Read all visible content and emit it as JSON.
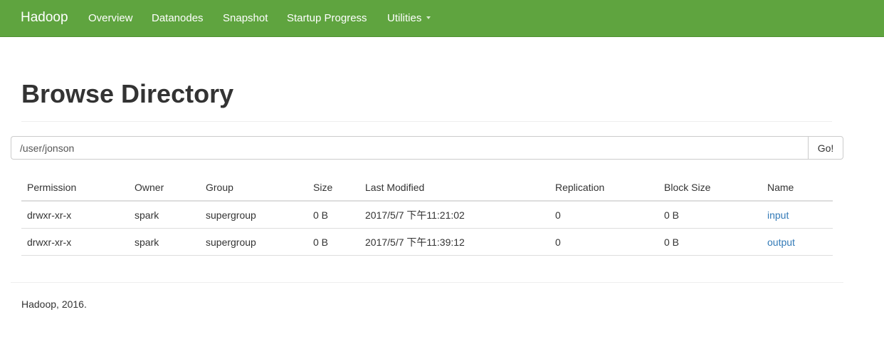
{
  "navbar": {
    "brand": "Hadoop",
    "items": [
      {
        "label": "Overview"
      },
      {
        "label": "Datanodes"
      },
      {
        "label": "Snapshot"
      },
      {
        "label": "Startup Progress"
      },
      {
        "label": "Utilities",
        "has_dropdown": true,
        "dropdown_icon": "caret-down-icon"
      }
    ],
    "color": "#5fa43f"
  },
  "page": {
    "title": "Browse Directory"
  },
  "path_bar": {
    "value": "/user/jonson",
    "go_label": "Go!"
  },
  "table": {
    "columns": [
      "Permission",
      "Owner",
      "Group",
      "Size",
      "Last Modified",
      "Replication",
      "Block Size",
      "Name"
    ],
    "rows": [
      {
        "permission": "drwxr-xr-x",
        "owner": "spark",
        "group": "supergroup",
        "size": "0 B",
        "last_modified": "2017/5/7 下午11:21:02",
        "replication": "0",
        "block_size": "0 B",
        "name": "input"
      },
      {
        "permission": "drwxr-xr-x",
        "owner": "spark",
        "group": "supergroup",
        "size": "0 B",
        "last_modified": "2017/5/7 下午11:39:12",
        "replication": "0",
        "block_size": "0 B",
        "name": "output"
      }
    ],
    "link_color": "#337ab7"
  },
  "footer": {
    "text": "Hadoop, 2016."
  }
}
